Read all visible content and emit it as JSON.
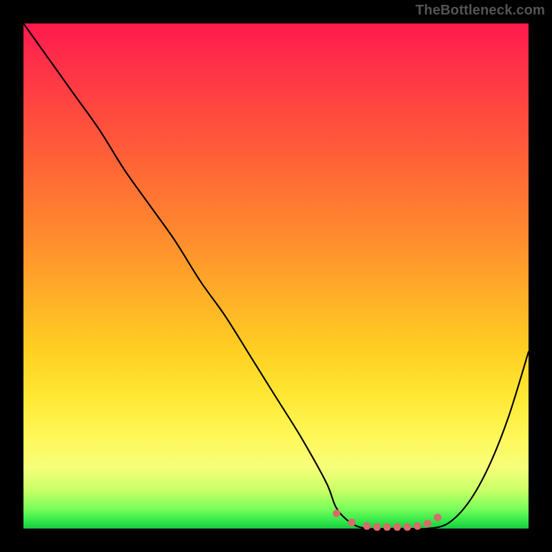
{
  "watermark": "TheBottleneck.com",
  "chart_data": {
    "type": "line",
    "title": "",
    "xlabel": "",
    "ylabel": "",
    "xlim": [
      0,
      100
    ],
    "ylim": [
      0,
      100
    ],
    "series": [
      {
        "name": "bottleneck-curve",
        "x": [
          0,
          5,
          10,
          15,
          20,
          25,
          30,
          35,
          40,
          45,
          50,
          55,
          60,
          62,
          65,
          68,
          72,
          76,
          80,
          84,
          88,
          92,
          96,
          100
        ],
        "values": [
          100,
          93,
          86,
          79,
          71,
          64,
          57,
          49,
          42,
          34,
          26,
          18,
          9,
          4,
          1,
          0,
          0,
          0,
          0,
          1,
          5,
          12,
          22,
          35
        ]
      }
    ],
    "markers": {
      "name": "flat-region-dots",
      "x": [
        62,
        65,
        68,
        70,
        72,
        74,
        76,
        78,
        80,
        82
      ],
      "values": [
        3,
        1.2,
        0.5,
        0.3,
        0.3,
        0.3,
        0.3,
        0.5,
        1,
        2.2
      ],
      "color": "#d96a6a"
    },
    "gradient_stops": [
      {
        "pos": 0.0,
        "color": "#ff1a4d"
      },
      {
        "pos": 0.18,
        "color": "#ff4a3e"
      },
      {
        "pos": 0.42,
        "color": "#ff8b2e"
      },
      {
        "pos": 0.65,
        "color": "#ffd022"
      },
      {
        "pos": 0.82,
        "color": "#fff85a"
      },
      {
        "pos": 0.93,
        "color": "#c8ff66"
      },
      {
        "pos": 1.0,
        "color": "#18c93f"
      }
    ]
  }
}
